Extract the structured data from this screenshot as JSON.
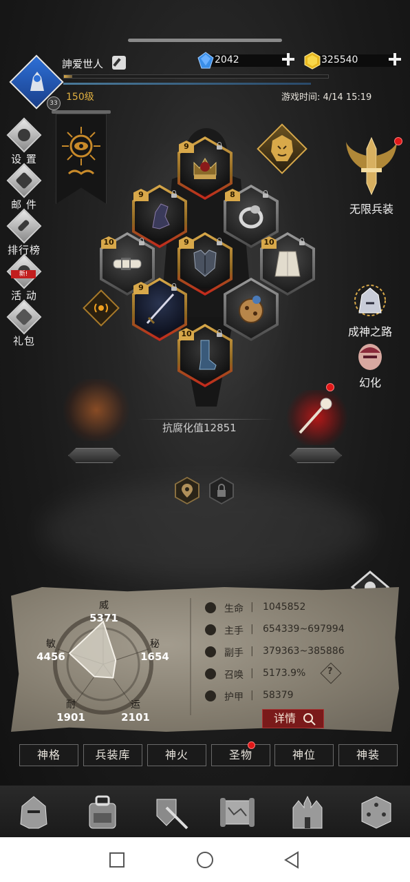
{
  "player": {
    "name": "訷爱世人",
    "badge_level": "33",
    "level": "150级",
    "xp_fraction": 0.03
  },
  "currency": {
    "gems": "2042",
    "gold": "325540"
  },
  "game_time": "游戏时间: 4/14 15:19",
  "left_menu": [
    {
      "label": "设 置",
      "icon": "gear-icon"
    },
    {
      "label": "邮 件",
      "icon": "mail-icon"
    },
    {
      "label": "排行榜",
      "icon": "ranking-icon"
    },
    {
      "label": "活 动",
      "icon": "event-icon",
      "tag": "新!"
    },
    {
      "label": "礼包",
      "icon": "gift-icon"
    }
  ],
  "equipment": [
    {
      "slot": "crown",
      "level": "9"
    },
    {
      "slot": "gloves",
      "level": "9"
    },
    {
      "slot": "ring",
      "level": "8"
    },
    {
      "slot": "belt",
      "level": "10"
    },
    {
      "slot": "armor",
      "level": "9"
    },
    {
      "slot": "skirt",
      "level": "10"
    },
    {
      "slot": "sword",
      "level": "9"
    },
    {
      "slot": "orb",
      "level": ""
    },
    {
      "slot": "boots",
      "level": "10"
    }
  ],
  "right_features": {
    "infinite_weapons": "无限兵装",
    "path_to_godhood": "成神之路",
    "transform": "幻化"
  },
  "corruption_resistance": "抗腐化值12851",
  "radar": {
    "wei": {
      "label": "威",
      "value": "5371"
    },
    "mi": {
      "label": "秘",
      "value": "1654"
    },
    "yun": {
      "label": "运",
      "value": "2101"
    },
    "nai": {
      "label": "耐",
      "value": "1901"
    },
    "min": {
      "label": "敏",
      "value": "4456"
    }
  },
  "stats": [
    {
      "label": "生命",
      "value": "1045852",
      "icon": "heart-icon"
    },
    {
      "label": "主手",
      "value": "654339~697994",
      "icon": "sword-icon"
    },
    {
      "label": "副手",
      "value": "379363~385886",
      "icon": "offhand-icon"
    },
    {
      "label": "召唤",
      "value": "5173.9%",
      "icon": "summon-icon"
    },
    {
      "label": "护甲",
      "value": "58379",
      "icon": "armor-icon"
    }
  ],
  "stats_sep": "|",
  "detail_button": "详情",
  "help_mark": "?",
  "tabs": [
    "神格",
    "兵装库",
    "神火",
    "圣物",
    "神位",
    "神装"
  ],
  "colors": {
    "gold": "#d8a94a",
    "blood_red": "#c8261c",
    "parchment": "#8f887a",
    "accent_blue": "#2d6fd6"
  }
}
